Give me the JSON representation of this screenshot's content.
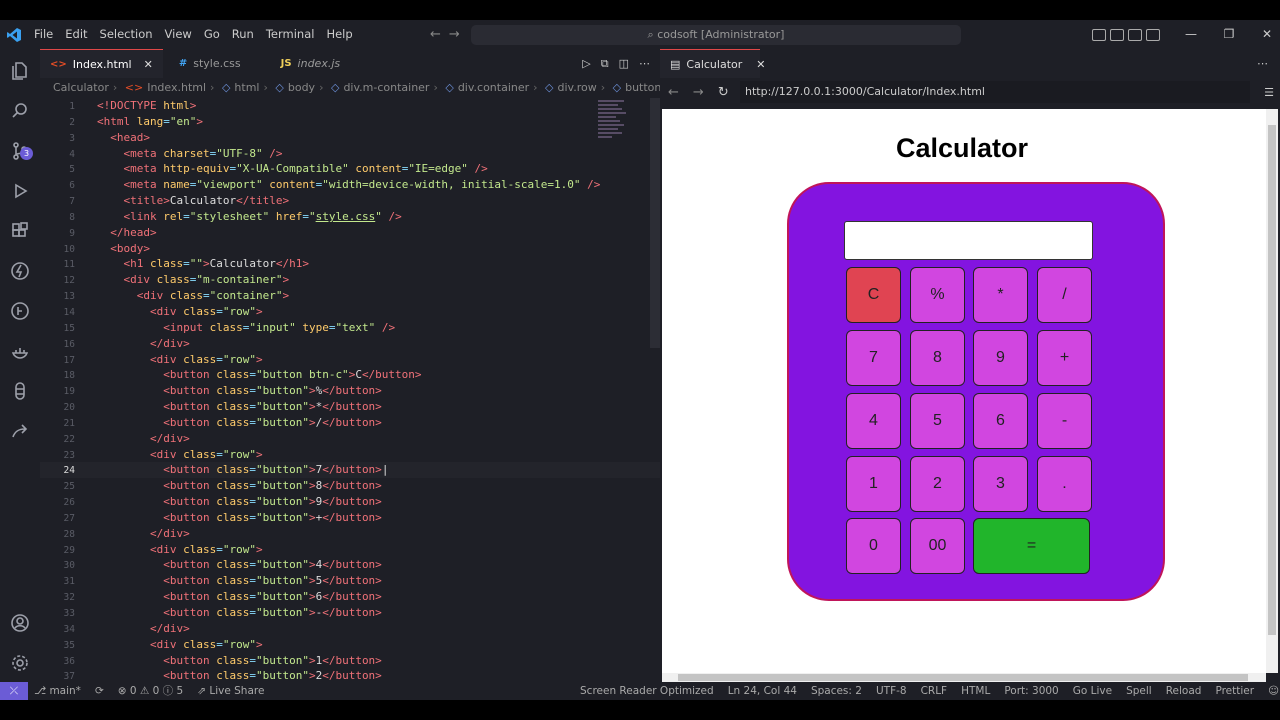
{
  "titlebar": {
    "menu": [
      "File",
      "Edit",
      "Selection",
      "View",
      "Go",
      "Run",
      "Terminal",
      "Help"
    ],
    "search": "codsoft [Administrator]"
  },
  "editor": {
    "tabs": [
      {
        "icon": "<>",
        "label": "Index.html",
        "close": "✕"
      },
      {
        "icon": "#",
        "label": "style.css"
      },
      {
        "icon": "JS",
        "label": "index.js"
      }
    ],
    "breadcrumb": [
      "Calculator",
      "Index.html",
      "html",
      "body",
      "div.m-container",
      "div.container",
      "div.row",
      "button.button"
    ],
    "cursor_line": 24
  },
  "preview": {
    "tab_label": "Calculator",
    "url": "http://127.0.0.1:3000/Calculator/Index.html",
    "page": {
      "title": "Calculator",
      "keys": [
        "C",
        "%",
        "*",
        "/",
        "7",
        "8",
        "9",
        "+",
        "4",
        "5",
        "6",
        "-",
        "1",
        "2",
        "3",
        ".",
        "0",
        "00",
        "="
      ]
    }
  },
  "statusbar": {
    "left": [
      "main*",
      "⊗ 0 ⚠ 0 ⓘ 5",
      "Live Share"
    ],
    "right": [
      "Screen Reader Optimized",
      "Ln 24, Col 44",
      "Spaces: 2",
      "UTF-8",
      "CRLF",
      "HTML",
      "Port: 3000",
      "Go Live",
      "Spell",
      "Reload",
      "Prettier"
    ]
  },
  "colors": {
    "calc_body": "#8314e0",
    "key": "#d146e0",
    "key_clear": "#e04452",
    "key_equals": "#21b52b",
    "accent": "#6b5cd6"
  }
}
